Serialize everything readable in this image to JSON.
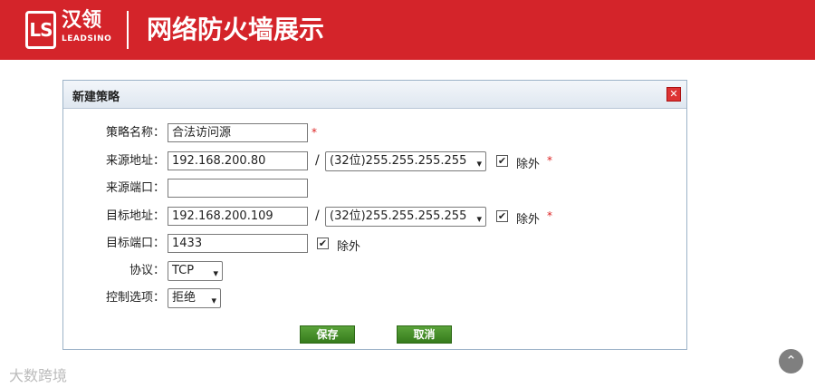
{
  "header": {
    "logo_mark": "LS",
    "logo_cn": "汉领",
    "logo_en": "LEADSINO",
    "title": "网络防火墙展示"
  },
  "dialog": {
    "title": "新建策略",
    "close_glyph": "✕",
    "fields": {
      "policy_name": {
        "label": "策略名称：",
        "value": "合法访问源"
      },
      "source_addr": {
        "label": "来源地址：",
        "value": "192.168.200.80",
        "mask": "(32位)255.255.255.255",
        "exclude_label": "除外",
        "exclude_checked": true
      },
      "source_port": {
        "label": "来源端口：",
        "value": ""
      },
      "dest_addr": {
        "label": "目标地址：",
        "value": "192.168.200.109",
        "mask": "(32位)255.255.255.255",
        "exclude_label": "除外",
        "exclude_checked": true
      },
      "dest_port": {
        "label": "目标端口：",
        "value": "1433",
        "exclude_label": "除外",
        "exclude_checked": true
      },
      "protocol": {
        "label": "协议：",
        "value": "TCP"
      },
      "control": {
        "label": "控制选项：",
        "value": "拒绝"
      }
    },
    "required_mark": "*",
    "slash": "/",
    "save_label": "保存",
    "cancel_label": "取消"
  },
  "watermark": "大数跨境",
  "colors": {
    "banner": "#d4242a",
    "button": "#4a8f2c",
    "close": "#dd3333"
  },
  "icons": {
    "check": "✔",
    "chevron": "⌄",
    "scroll_up": "⌃"
  }
}
